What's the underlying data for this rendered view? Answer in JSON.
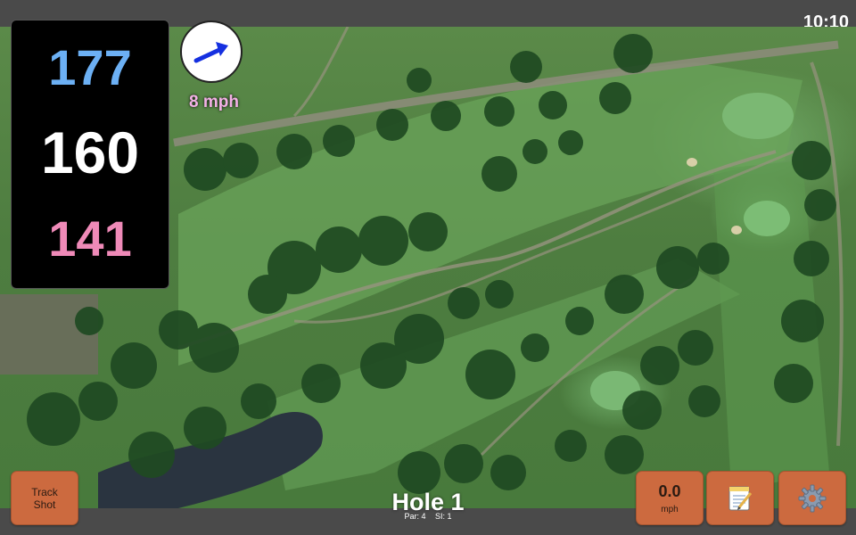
{
  "status": {
    "time": "10:10"
  },
  "distances": {
    "back": "177",
    "middle": "160",
    "front": "141"
  },
  "wind": {
    "speed": "8 mph",
    "icon": "wind-arrow-icon"
  },
  "buttons": {
    "track_shot_line1": "Track",
    "track_shot_line2": "Shot",
    "speed_value": "0.0",
    "speed_unit": "mph",
    "notes_icon": "notepad-icon",
    "settings_icon": "gear-icon"
  },
  "hole": {
    "title": "Hole 1",
    "par": "Par: 4",
    "si": "SI: 1"
  },
  "colors": {
    "back": "#6cb0f4",
    "middle": "#ffffff",
    "front": "#ef8ab8",
    "wind_text": "#f3b1e6",
    "button": "#cc6a3f"
  }
}
